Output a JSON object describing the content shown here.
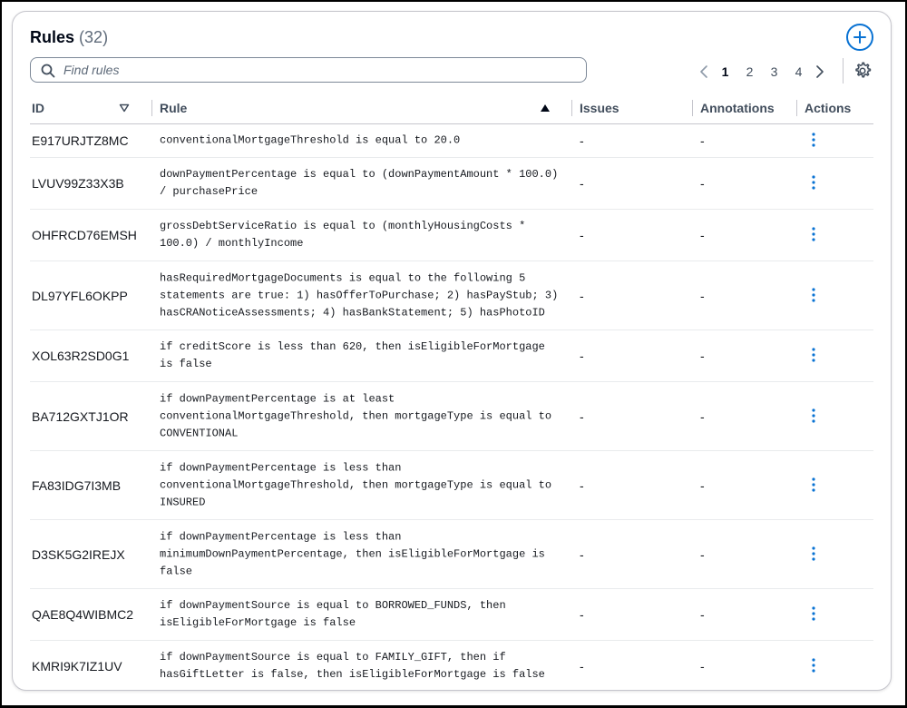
{
  "header": {
    "title": "Rules",
    "count": "(32)",
    "add_icon": "plus-circle-icon"
  },
  "search": {
    "placeholder": "Find rules",
    "value": ""
  },
  "pagination": {
    "pages": [
      "1",
      "2",
      "3",
      "4"
    ],
    "current": "1"
  },
  "table": {
    "columns": [
      "ID",
      "Rule",
      "Issues",
      "Annotations",
      "Actions"
    ],
    "rows": [
      {
        "id": "E917URJTZ8MC",
        "rule": "conventionalMortgageThreshold is equal to 20.0",
        "issues": "-",
        "annotations": "-"
      },
      {
        "id": "LVUV99Z33X3B",
        "rule": "downPaymentPercentage is equal to (downPaymentAmount * 100.0)\n/ purchasePrice",
        "issues": "-",
        "annotations": "-"
      },
      {
        "id": "OHFRCD76EMSH",
        "rule": "grossDebtServiceRatio is equal to (monthlyHousingCosts *\n100.0) / monthlyIncome",
        "issues": "-",
        "annotations": "-"
      },
      {
        "id": "DL97YFL6OKPP",
        "rule": "hasRequiredMortgageDocuments is equal to the following 5\nstatements are true: 1) hasOfferToPurchase; 2) hasPayStub; 3)\nhasCRANoticeAssessments; 4) hasBankStatement; 5) hasPhotoID",
        "issues": "-",
        "annotations": "-"
      },
      {
        "id": "XOL63R2SD0G1",
        "rule": "if creditScore is less than 620, then isEligibleForMortgage\nis false",
        "issues": "-",
        "annotations": "-"
      },
      {
        "id": "BA712GXTJ1OR",
        "rule": "if downPaymentPercentage is at least\nconventionalMortgageThreshold, then mortgageType is equal to\nCONVENTIONAL",
        "issues": "-",
        "annotations": "-"
      },
      {
        "id": "FA83IDG7I3MB",
        "rule": "if downPaymentPercentage is less than\nconventionalMortgageThreshold, then mortgageType is equal to\nINSURED",
        "issues": "-",
        "annotations": "-"
      },
      {
        "id": "D3SK5G2IREJX",
        "rule": "if downPaymentPercentage is less than\nminimumDownPaymentPercentage, then isEligibleForMortgage is\nfalse",
        "issues": "-",
        "annotations": "-"
      },
      {
        "id": "QAE8Q4WIBMC2",
        "rule": "if downPaymentSource is equal to BORROWED_FUNDS, then\nisEligibleForMortgage is false",
        "issues": "-",
        "annotations": "-"
      },
      {
        "id": "KMRI9K7IZ1UV",
        "rule": "if downPaymentSource is equal to FAMILY_GIFT, then if\nhasGiftLetter is false, then isEligibleForMortgage is false",
        "issues": "-",
        "annotations": "-"
      }
    ]
  },
  "colors": {
    "accent": "#0972d3",
    "text": "#16191f",
    "muted": "#5f6b7a",
    "border": "#c6c6cd"
  }
}
